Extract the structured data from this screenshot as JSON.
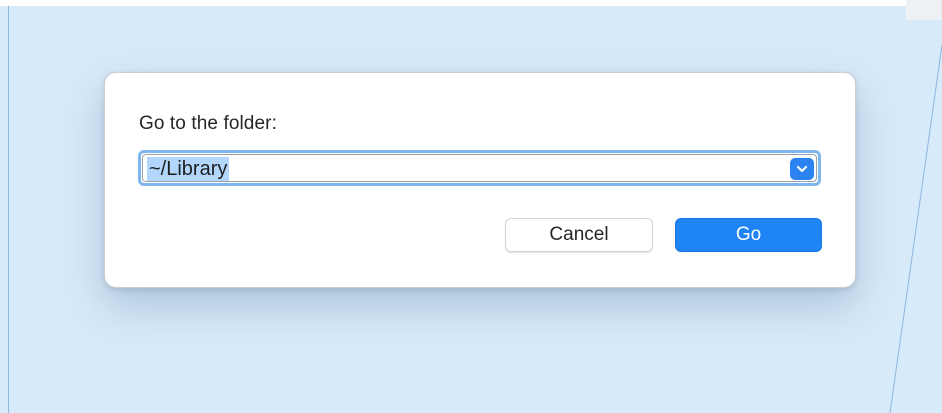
{
  "dialog": {
    "prompt": "Go to the folder:",
    "path_value": "~/Library",
    "path_selected": true,
    "cancel_label": "Cancel",
    "go_label": "Go"
  },
  "icons": {
    "dropdown": "chevron-down-icon"
  },
  "colors": {
    "desktop_background": "#d6eaf9",
    "accent": "#1f84f5",
    "focus_ring": "#7fb6ee",
    "selection": "#b3d7fc"
  }
}
